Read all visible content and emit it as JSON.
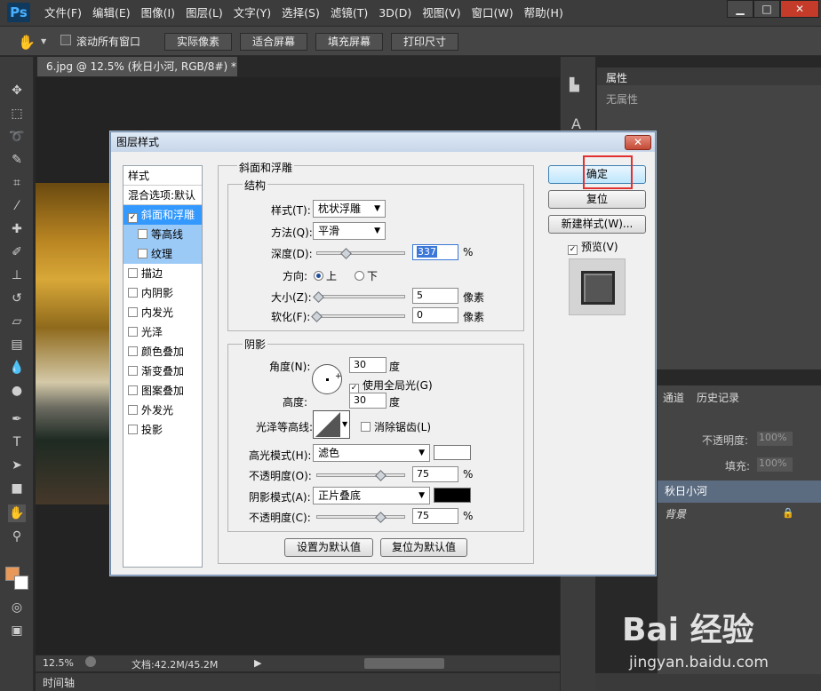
{
  "app": {
    "logo": "Ps",
    "menus": [
      "文件(F)",
      "编辑(E)",
      "图像(I)",
      "图层(L)",
      "文字(Y)",
      "选择(S)",
      "滤镜(T)",
      "3D(D)",
      "视图(V)",
      "窗口(W)",
      "帮助(H)"
    ]
  },
  "options": {
    "scroll_all": "滚动所有窗口",
    "actual_pixels": "实际像素",
    "fit_screen": "适合屏幕",
    "fill_screen": "填充屏幕",
    "print_size": "打印尺寸"
  },
  "document": {
    "tab": "6.jpg @ 12.5% (秋日小河, RGB/8#) *",
    "zoom": "12.5%",
    "doc_size": "文档:42.2M/45.2M",
    "timeline": "时间轴"
  },
  "properties": {
    "title": "属性",
    "empty": "无属性"
  },
  "layers": {
    "tab_channels": "通道",
    "tab_history": "历史记录",
    "opacity_label": "不透明度:",
    "opacity_value": "100%",
    "fill_label": "填充:",
    "fill_value": "100%",
    "rows": [
      "秋日小河",
      "背景"
    ]
  },
  "dialog": {
    "title": "图层样式",
    "close": "✕",
    "styles_header": "样式",
    "blend_options": "混合选项:默认",
    "style_items": [
      {
        "label": "斜面和浮雕",
        "checked": true,
        "selected": true,
        "indent": false
      },
      {
        "label": "等高线",
        "checked": false,
        "selected": true,
        "indent": true
      },
      {
        "label": "纹理",
        "checked": false,
        "selected": true,
        "indent": true
      },
      {
        "label": "描边",
        "checked": false
      },
      {
        "label": "内阴影",
        "checked": false
      },
      {
        "label": "内发光",
        "checked": false
      },
      {
        "label": "光泽",
        "checked": false
      },
      {
        "label": "颜色叠加",
        "checked": false
      },
      {
        "label": "渐变叠加",
        "checked": false
      },
      {
        "label": "图案叠加",
        "checked": false
      },
      {
        "label": "外发光",
        "checked": false
      },
      {
        "label": "投影",
        "checked": false
      }
    ],
    "section_title": "斜面和浮雕",
    "structure": {
      "title": "结构",
      "style_label": "样式(T):",
      "style_value": "枕状浮雕",
      "technique_label": "方法(Q):",
      "technique_value": "平滑",
      "depth_label": "深度(D):",
      "depth_value": "337",
      "depth_unit": "%",
      "depth_fraction": 0.34,
      "direction_label": "方向:",
      "dir_up": "上",
      "dir_down": "下",
      "size_label": "大小(Z):",
      "size_value": "5",
      "size_unit": "像素",
      "size_fraction": 0.02,
      "soften_label": "软化(F):",
      "soften_value": "0",
      "soften_unit": "像素",
      "soften_fraction": 0.0
    },
    "shading": {
      "title": "阴影",
      "angle_label": "角度(N):",
      "angle_value": "30",
      "angle_unit": "度",
      "global_light": "使用全局光(G)",
      "altitude_label": "高度:",
      "altitude_value": "30",
      "altitude_unit": "度",
      "gloss_label": "光泽等高线:",
      "anti_alias": "消除锯齿(L)",
      "highlight_label": "高光模式(H):",
      "highlight_value": "滤色",
      "highlight_color": "#ffffff",
      "hl_opacity_label": "不透明度(O):",
      "hl_opacity_value": "75",
      "hl_opacity_fraction": 0.75,
      "shadow_label": "阴影模式(A):",
      "shadow_value": "正片叠底",
      "shadow_color": "#000000",
      "sh_opacity_label": "不透明度(C):",
      "sh_opacity_value": "75",
      "sh_opacity_fraction": 0.75,
      "percent": "%"
    },
    "make_default": "设置为默认值",
    "reset_default": "复位为默认值",
    "ok": "确定",
    "reset": "复位",
    "new_style": "新建样式(W)...",
    "preview": "预览(V)"
  },
  "watermark": {
    "brand": "Bai 经验",
    "url": "jingyan.baidu.com"
  }
}
